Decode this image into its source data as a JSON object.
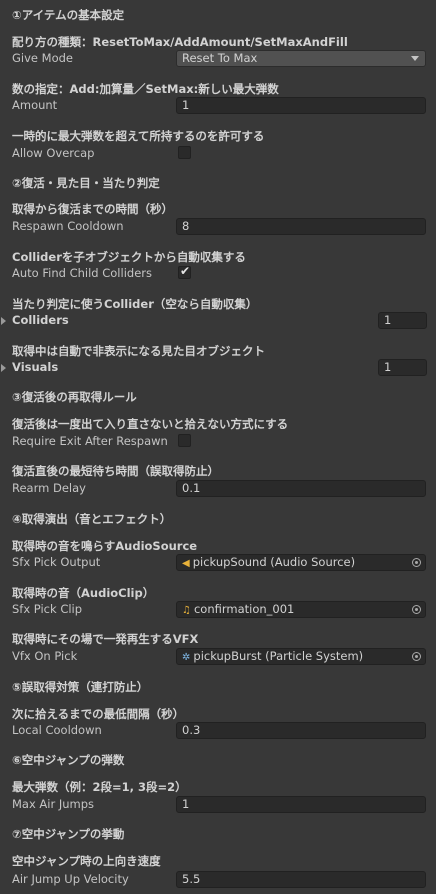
{
  "sections": {
    "s1": "①アイテムの基本設定",
    "s2": "②復活・見た目・当たり判定",
    "s3": "③復活後の再取得ルール",
    "s4": "④取得演出（音とエフェクト）",
    "s5": "⑤誤取得対策（連打防止）",
    "s6": "⑥空中ジャンプの弾数",
    "s7": "⑦空中ジャンプの挙動"
  },
  "fields": {
    "give_mode": {
      "tooltip": "配り方の種類：ResetToMax/AddAmount/SetMaxAndFill",
      "label": "Give Mode",
      "value": "Reset To Max"
    },
    "amount": {
      "tooltip": "数の指定：Add:加算量／SetMax:新しい最大弾数",
      "label": "Amount",
      "value": "1"
    },
    "allow_overcap": {
      "tooltip": "一時的に最大弾数を超えて所持するのを許可する",
      "label": "Allow Overcap",
      "checked": false
    },
    "respawn_cooldown": {
      "tooltip": "取得から復活までの時間（秒）",
      "label": "Respawn Cooldown",
      "value": "8"
    },
    "auto_find": {
      "tooltip": "Colliderを子オブジェクトから自動収集する",
      "label": "Auto Find Child Colliders",
      "checked": true
    },
    "colliders": {
      "tooltip": "当たり判定に使うCollider（空なら自動収集）",
      "label": "Colliders",
      "value": "1"
    },
    "visuals": {
      "tooltip": "取得中は自動で非表示になる見た目オブジェクト",
      "label": "Visuals",
      "value": "1"
    },
    "require_exit": {
      "tooltip": "復活後は一度出て入り直さないと拾えない方式にする",
      "label": "Require Exit After Respawn",
      "checked": false
    },
    "rearm_delay": {
      "tooltip": "復活直後の最短待ち時間（誤取得防止）",
      "label": "Rearm Delay",
      "value": "0.1"
    },
    "sfx_output": {
      "tooltip": "取得時の音を鳴らすAudioSource",
      "label": "Sfx Pick Output",
      "value": "pickupSound (Audio Source)",
      "icon": "audio-source-icon"
    },
    "sfx_clip": {
      "tooltip": "取得時の音（AudioClip）",
      "label": "Sfx Pick Clip",
      "value": "confirmation_001",
      "icon": "audio-clip-icon"
    },
    "vfx": {
      "tooltip": "取得時にその場で一発再生するVFX",
      "label": "Vfx On Pick",
      "value": "pickupBurst (Particle System)",
      "icon": "particle-system-icon"
    },
    "local_cooldown": {
      "tooltip": "次に拾えるまでの最低間隔（秒）",
      "label": "Local Cooldown",
      "value": "0.3"
    },
    "max_air_jumps": {
      "tooltip": "最大弾数（例：2段=1, 3段=2）",
      "label": "Max Air Jumps",
      "value": "1"
    },
    "air_jump_up": {
      "tooltip": "空中ジャンプ時の上向き速度",
      "label": "Air Jump Up Velocity",
      "value": "5.5"
    }
  }
}
